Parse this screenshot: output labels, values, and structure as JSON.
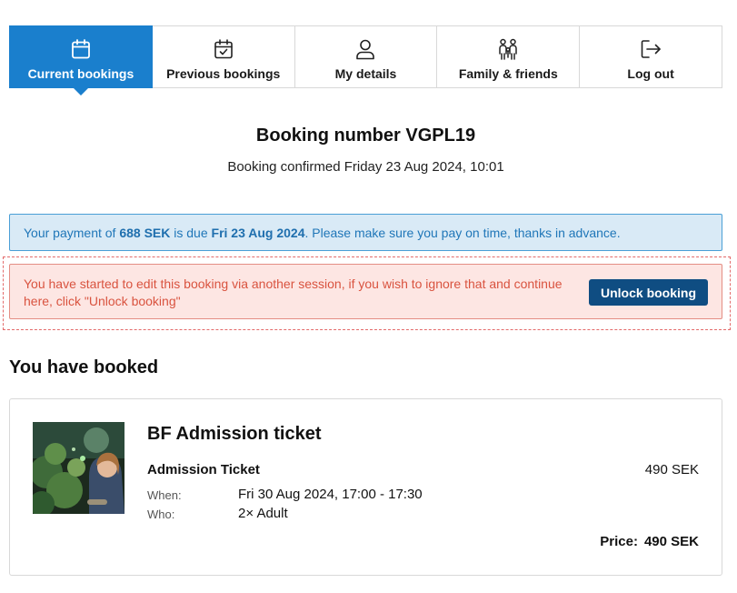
{
  "tabs": [
    {
      "label": "Current bookings",
      "icon": "calendar-icon",
      "active": true
    },
    {
      "label": "Previous bookings",
      "icon": "calendar-check-icon",
      "active": false
    },
    {
      "label": "My details",
      "icon": "user-icon",
      "active": false
    },
    {
      "label": "Family & friends",
      "icon": "family-icon",
      "active": false
    },
    {
      "label": "Log out",
      "icon": "logout-icon",
      "active": false
    }
  ],
  "booking": {
    "title": "Booking number VGPL19",
    "confirmed": "Booking confirmed Friday 23 Aug 2024, 10:01"
  },
  "payment_alert": {
    "text_1": "Your payment of ",
    "amount": "688 SEK",
    "text_2": " is due ",
    "due_date": "Fri 23 Aug 2024",
    "text_3": ". Please make sure you pay on time, thanks in advance."
  },
  "lock_alert": {
    "message": "You have started to edit this booking via another session, if you wish to ignore that and continue here, click \"Unlock booking\"",
    "button_label": "Unlock booking"
  },
  "booked": {
    "section_title": "You have booked",
    "item": {
      "title": "BF Admission ticket",
      "ticket_name": "Admission Ticket",
      "ticket_price": "490 SEK",
      "when_label": "When:",
      "when_value": "Fri 30 Aug 2024, 17:00 - 17:30",
      "who_label": "Who:",
      "who_value": "2× Adult",
      "price_label": "Price:",
      "price_value": "490 SEK"
    }
  },
  "colors": {
    "primary": "#1a7fcd",
    "info_bg": "#d9eaf6",
    "info_text": "#1f76b8",
    "danger_bg": "#fde6e3",
    "danger_text": "#d9533f",
    "button_dark": "#0f4d82"
  }
}
